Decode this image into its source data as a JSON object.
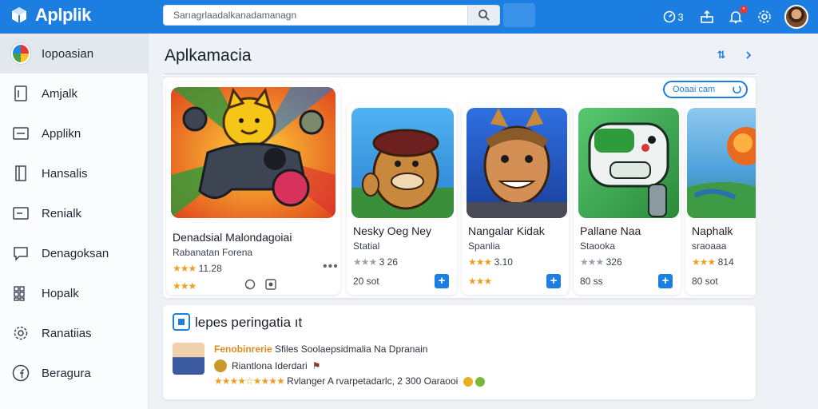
{
  "topbar": {
    "logo_text": "Aplplik",
    "search_placeholder": "Sarıagrlaadalkanadamanagn",
    "stats_count": "3",
    "notif_badge": "•"
  },
  "sidebar": {
    "items": [
      {
        "label": "Iopoasian",
        "icon": "color-wheel-icon"
      },
      {
        "label": "Amjalk",
        "icon": "document-icon"
      },
      {
        "label": "Applikn",
        "icon": "inbox-icon"
      },
      {
        "label": "Hansalis",
        "icon": "book-icon"
      },
      {
        "label": "Renialk",
        "icon": "minus-box-icon"
      },
      {
        "label": "Denagoksan",
        "icon": "chat-icon"
      },
      {
        "label": "Hopalk",
        "icon": "grid-icon"
      },
      {
        "label": "Ranatiias",
        "icon": "gear-icon"
      },
      {
        "label": "Beragura",
        "icon": "facebook-icon"
      }
    ]
  },
  "main": {
    "title": "Aplkamacia",
    "header_action": "⇅",
    "chip_label": "Ooaai cam",
    "apps": [
      {
        "name": "Denadsial Malondagoiai",
        "sub": "Rabanatan Forena",
        "rating": "★★★",
        "rating_text": "11.28",
        "extra_stars": "★★★"
      },
      {
        "name": "Nesky Oeg Ney",
        "sub": "Statial",
        "rating": "★★★",
        "rating_text": "3 26",
        "extra": "20 sot"
      },
      {
        "name": "Nangalar Kidak",
        "sub": "Spanlia",
        "rating": "★★★",
        "rating_text": "3.10",
        "extra_stars": "★★★"
      },
      {
        "name": "Pallane Naa",
        "sub": "Staooka",
        "rating": "★★★",
        "rating_text": "326",
        "extra": "80 ss"
      },
      {
        "name": "Naphalk",
        "sub": "sraoaaa",
        "rating": "★★★",
        "rating_text": "814",
        "extra": "80 sot"
      }
    ]
  },
  "reviews": {
    "title": "lepes peringatia ıt",
    "author": "Fenobinrerie",
    "line1_text": "Sfiles Soolaepsidmalia Na Dpranain",
    "line2_text": "Riantlona Iderdari",
    "line3_stars": "★★★★☆★★★★",
    "line3_text": "Rvlanger A rvarpetadarlc, 2 300 Oaraooi"
  }
}
